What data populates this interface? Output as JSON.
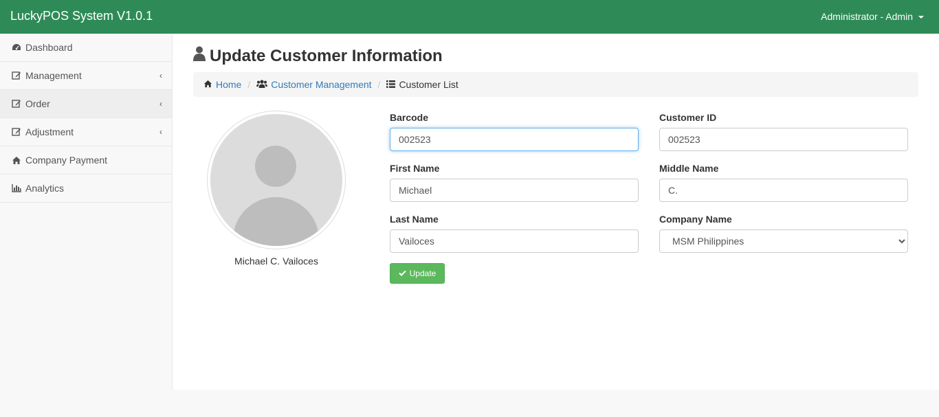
{
  "app": {
    "title": "LuckyPOS System V1.0.1",
    "user_menu": "Administrator - Admin"
  },
  "sidebar": {
    "items": [
      {
        "label": "Dashboard",
        "icon": "dashboard-icon"
      },
      {
        "label": "Management",
        "icon": "edit-icon",
        "has_submenu": true
      },
      {
        "label": "Order",
        "icon": "edit-icon",
        "has_submenu": true,
        "active": true
      },
      {
        "label": "Adjustment",
        "icon": "edit-icon",
        "has_submenu": true
      },
      {
        "label": "Company Payment",
        "icon": "home-icon"
      },
      {
        "label": "Analytics",
        "icon": "bar-chart-icon"
      }
    ]
  },
  "page": {
    "title": "Update Customer Information"
  },
  "breadcrumb": {
    "home": "Home",
    "customer_management": "Customer Management",
    "customer_list": "Customer List"
  },
  "profile": {
    "name": "Michael C. Vailoces"
  },
  "form": {
    "barcode": {
      "label": "Barcode",
      "value": "002523"
    },
    "customer_id": {
      "label": "Customer ID",
      "value": "002523"
    },
    "first_name": {
      "label": "First Name",
      "value": "Michael"
    },
    "middle_name": {
      "label": "Middle Name",
      "value": "C."
    },
    "last_name": {
      "label": "Last Name",
      "value": "Vailoces"
    },
    "company_name": {
      "label": "Company Name",
      "value": "MSM Philippines"
    },
    "update_button": "Update"
  },
  "colors": {
    "topbar": "#2e8b57",
    "link": "#337ab7",
    "success": "#5cb85c"
  }
}
